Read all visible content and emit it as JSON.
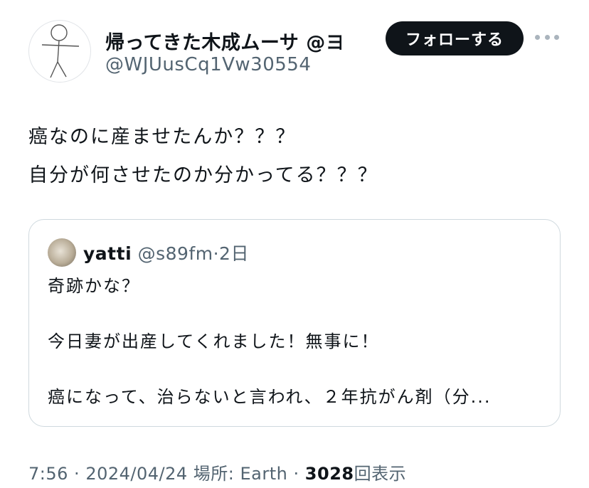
{
  "author": {
    "display_name": "帰ってきた木成ムーサ @ヨ",
    "handle": "@WJUusCq1Vw30554",
    "avatar_icon": "stick-figure-icon"
  },
  "follow_button": {
    "label": "フォローする"
  },
  "more_icon": "more-dots-icon",
  "tweet": {
    "lines": [
      "癌なのに産ませたんか？？？",
      "自分が何させたのか分かってる？？？"
    ]
  },
  "quote": {
    "name": "yatti",
    "handle": "@s89fm",
    "separator": "·",
    "time": "2日",
    "lines": [
      "奇跡かな？",
      "",
      "今日妻が出産してくれました！無事に！",
      "",
      "癌になって、治らないと言われ、２年抗がん剤（分..."
    ]
  },
  "meta": {
    "time": "7:56",
    "sep1": "·",
    "date": "2024/04/24",
    "location_label": "場所: Earth",
    "sep2": "·",
    "views_count": "3028",
    "views_label": "回表示"
  },
  "colors": {
    "text": "#0f1419",
    "secondary": "#536471",
    "button_bg": "#0f1419",
    "border": "#cfd9de"
  }
}
